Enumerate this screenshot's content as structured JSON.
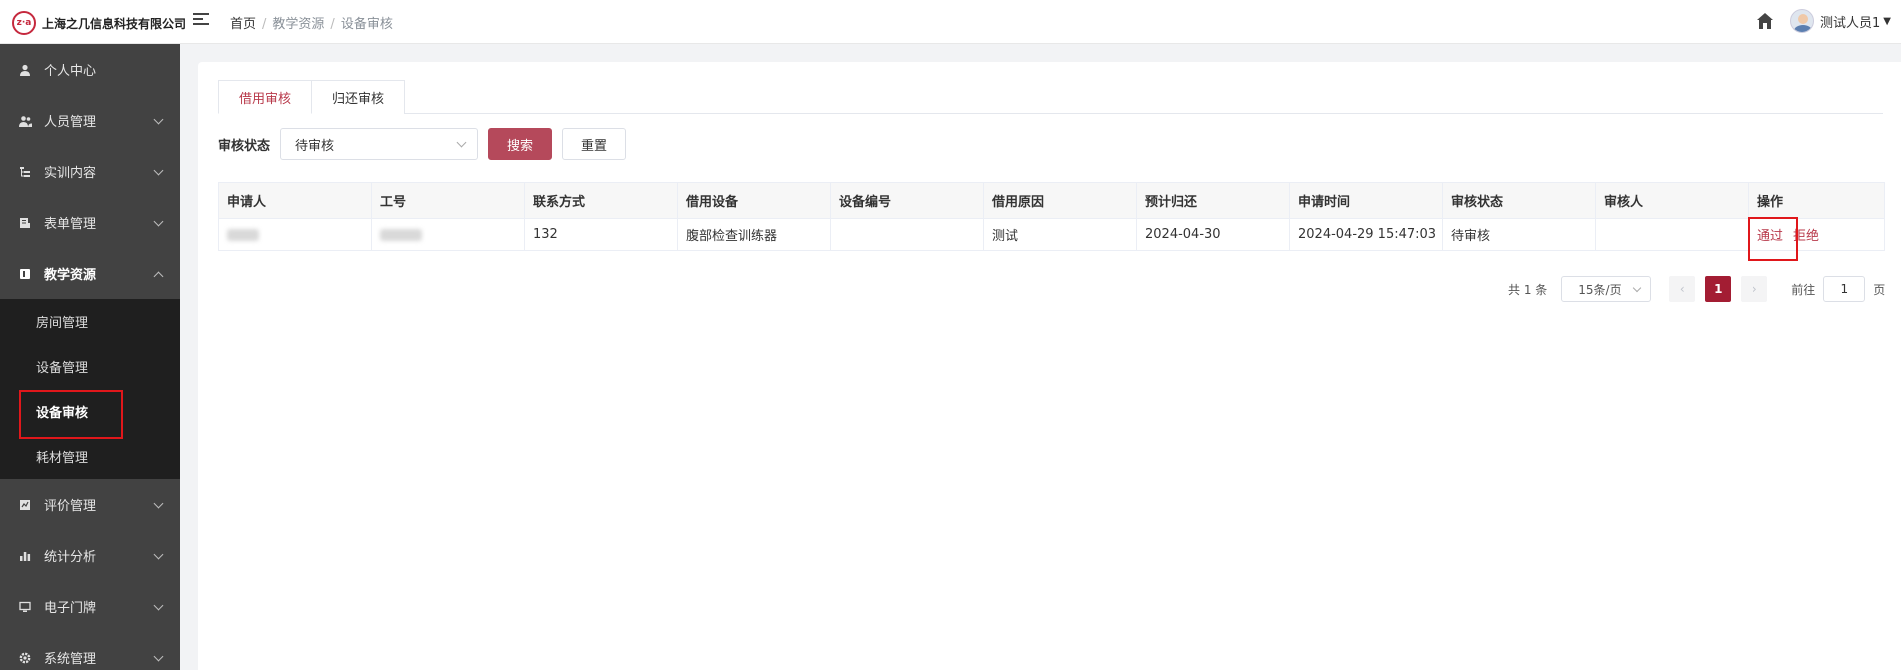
{
  "company": {
    "logo_mark": "z·a",
    "name": "上海之几信息科技有限公司"
  },
  "breadcrumb": [
    "首页",
    "教学资源",
    "设备审核"
  ],
  "user": {
    "name": "测试人员1"
  },
  "sidebar": {
    "items": [
      {
        "label": "个人中心",
        "icon": "user-icon"
      },
      {
        "label": "人员管理",
        "icon": "users-icon"
      },
      {
        "label": "实训内容",
        "icon": "tree-icon"
      },
      {
        "label": "表单管理",
        "icon": "form-icon"
      },
      {
        "label": "教学资源",
        "icon": "book-icon"
      },
      {
        "label": "评价管理",
        "icon": "rating-icon"
      },
      {
        "label": "统计分析",
        "icon": "chart-icon"
      },
      {
        "label": "电子门牌",
        "icon": "monitor-icon"
      },
      {
        "label": "系统管理",
        "icon": "gear-icon"
      }
    ],
    "submenu": [
      "房间管理",
      "设备管理",
      "设备审核",
      "耗材管理"
    ]
  },
  "tabs": [
    "借用审核",
    "归还审核"
  ],
  "filter": {
    "label": "审核状态",
    "value": "待审核",
    "search": "搜索",
    "reset": "重置"
  },
  "table": {
    "headers": [
      "申请人",
      "工号",
      "联系方式",
      "借用设备",
      "设备编号",
      "借用原因",
      "预计归还",
      "申请时间",
      "审核状态",
      "审核人",
      "操作"
    ],
    "rows": [
      {
        "contact": "132",
        "device": "腹部检查训练器",
        "device_no": "",
        "reason": "测试",
        "return_date": "2024-04-30",
        "apply_time": "2024-04-29 15:47:03",
        "status": "待审核",
        "reviewer": ""
      }
    ],
    "actions": {
      "pass": "通过",
      "reject": "拒绝"
    }
  },
  "pager": {
    "total": "共 1 条",
    "page_size": "15条/页",
    "current": "1",
    "goto": "前往",
    "goto_value": "1",
    "page_unit": "页"
  }
}
